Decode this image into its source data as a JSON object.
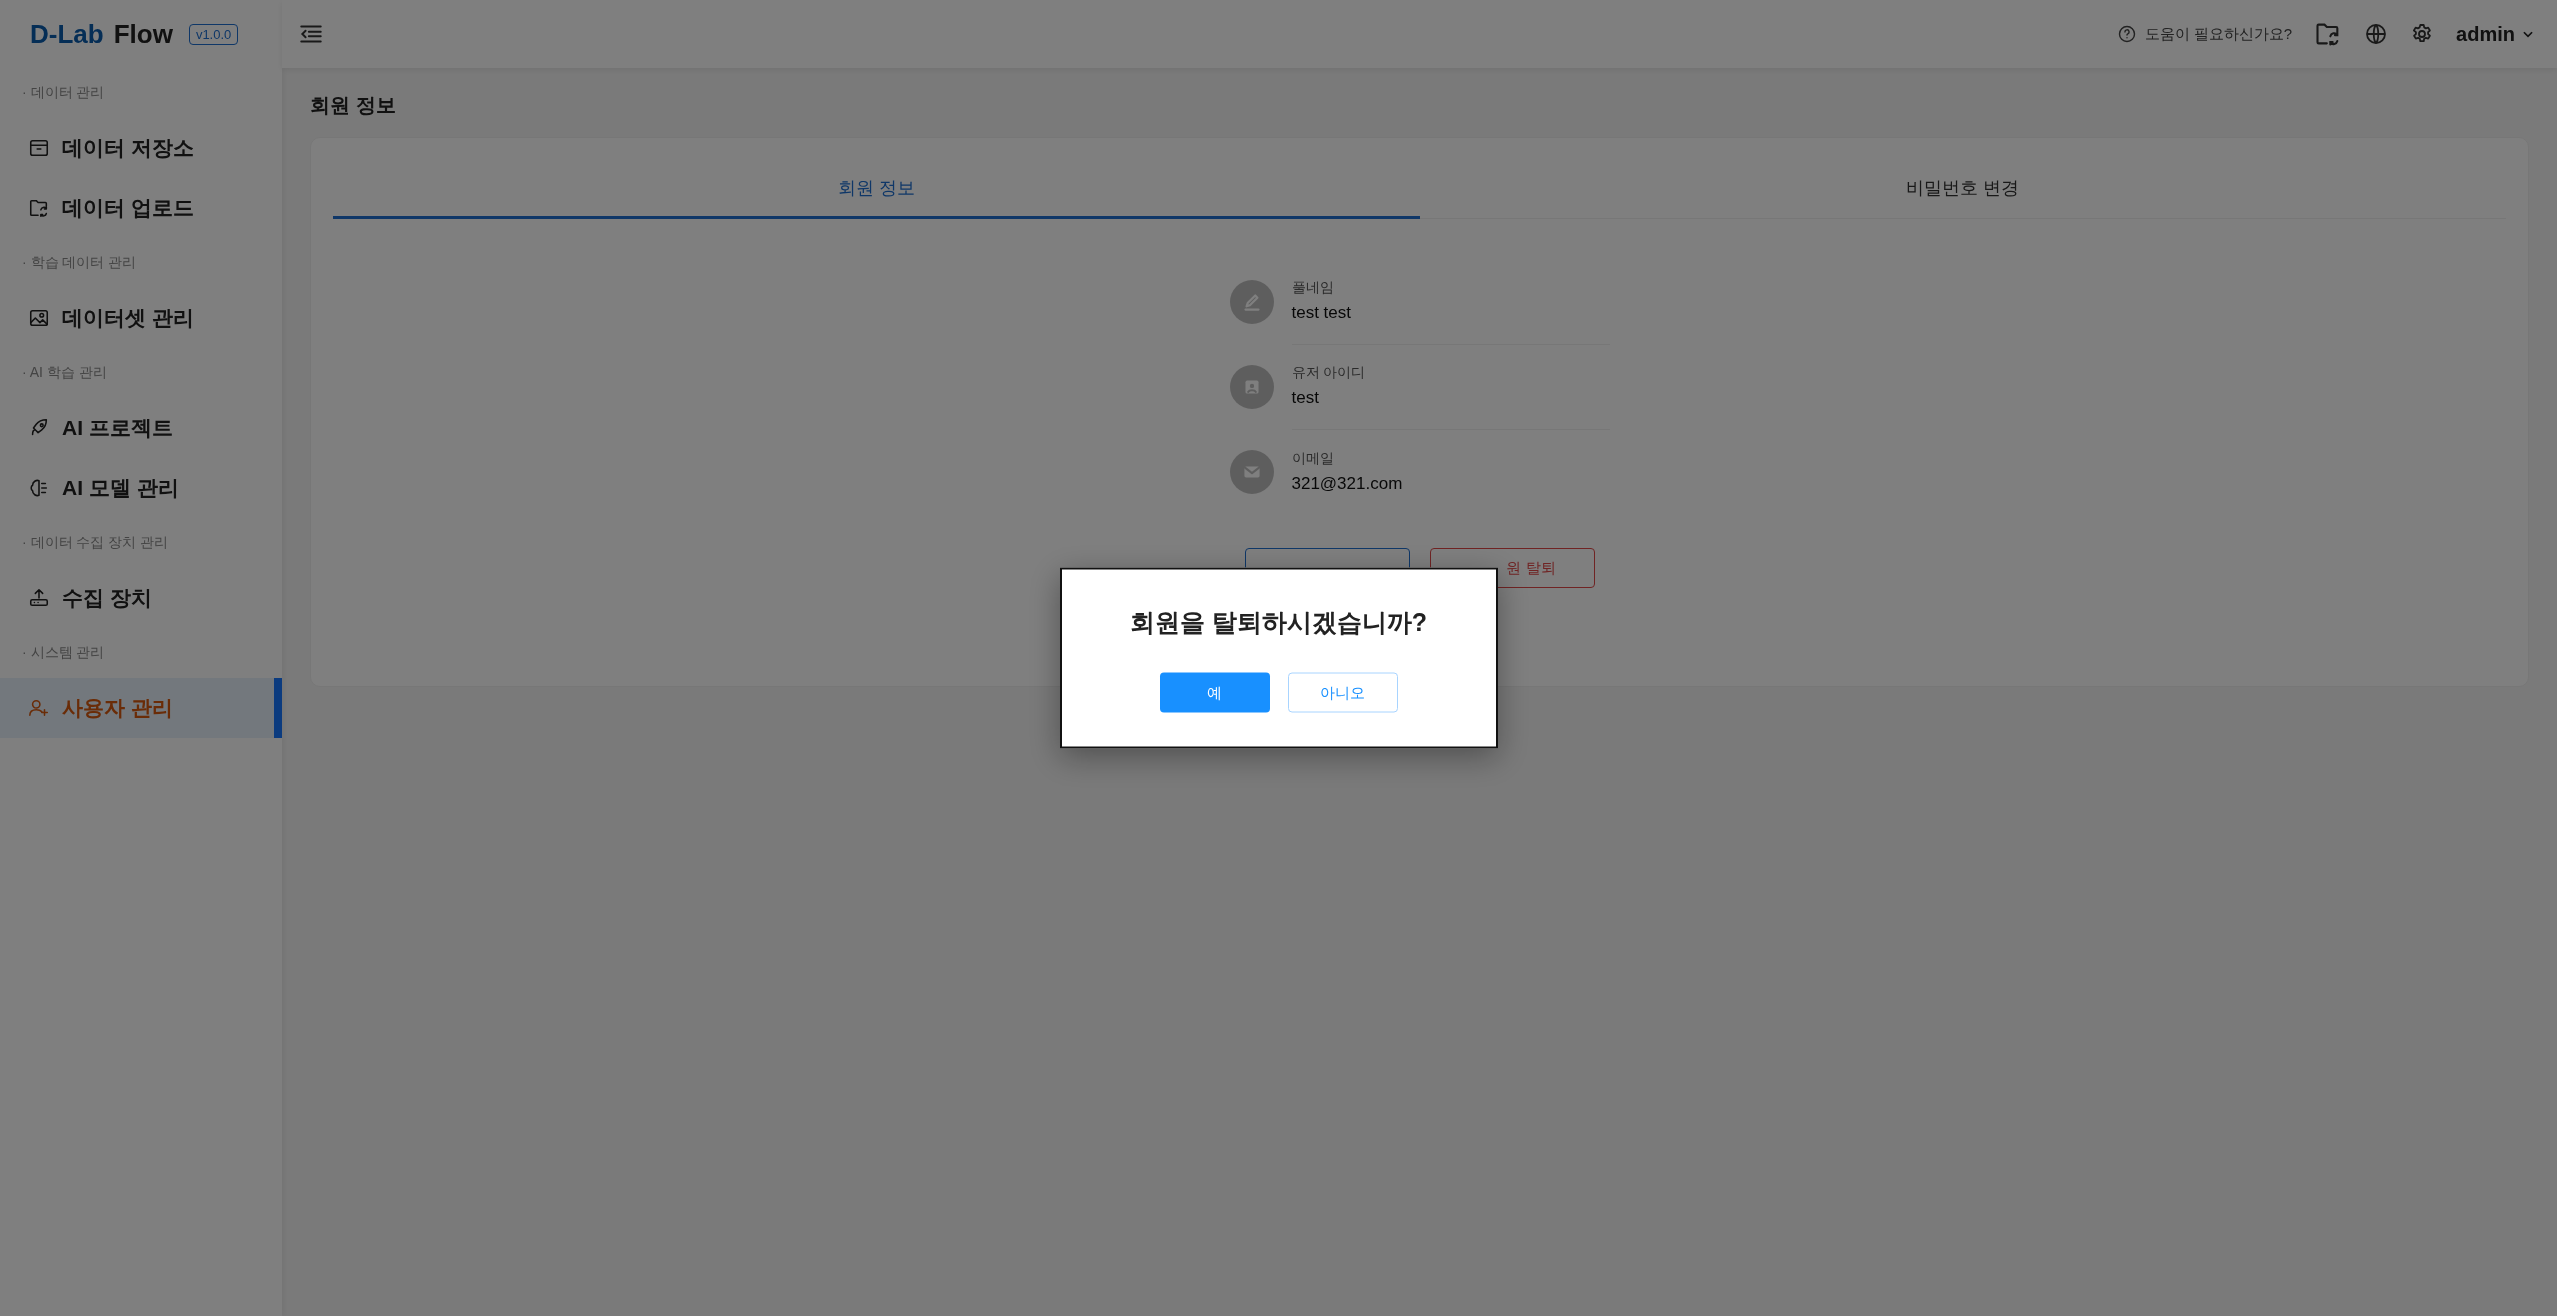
{
  "logo": {
    "brand": "D-Lab",
    "product": "Flow",
    "version": "v1.0.0"
  },
  "sidebar": {
    "sections": [
      {
        "title": "· 데이터 관리",
        "items": [
          {
            "label": "데이터 저장소",
            "selected": false
          },
          {
            "label": "데이터 업로드",
            "selected": false
          }
        ]
      },
      {
        "title": "· 학습 데이터 관리",
        "items": [
          {
            "label": "데이터셋 관리",
            "selected": false
          }
        ]
      },
      {
        "title": "· AI 학습 관리",
        "items": [
          {
            "label": "AI 프로젝트",
            "selected": false
          },
          {
            "label": "AI 모델 관리",
            "selected": false
          }
        ]
      },
      {
        "title": "· 데이터 수집 장치 관리",
        "items": [
          {
            "label": "수집 장치",
            "selected": false
          }
        ]
      },
      {
        "title": "· 시스템 관리",
        "items": [
          {
            "label": "사용자 관리",
            "selected": true
          }
        ]
      }
    ]
  },
  "header": {
    "help": "도움이 필요하신가요?",
    "user": "admin"
  },
  "page_title": "회원 정보",
  "tabs": [
    {
      "label": "회원 정보",
      "selected": true
    },
    {
      "label": "비밀번호 변경",
      "selected": false
    }
  ],
  "profile": [
    {
      "label": "풀네임",
      "value": "test test"
    },
    {
      "label": "유저 아이디",
      "value": "test"
    },
    {
      "label": "이메일",
      "value": "321@321.com"
    }
  ],
  "actions": [
    {
      "kind": "primary"
    },
    {
      "label": "원 탈퇴",
      "kind": "danger"
    }
  ],
  "dialog": {
    "message": "회원을 탈퇴하시겠습니까?",
    "buttons": [
      {
        "label": "예",
        "kind": "primary"
      },
      {
        "label": "아니오",
        "kind": "default"
      }
    ]
  }
}
